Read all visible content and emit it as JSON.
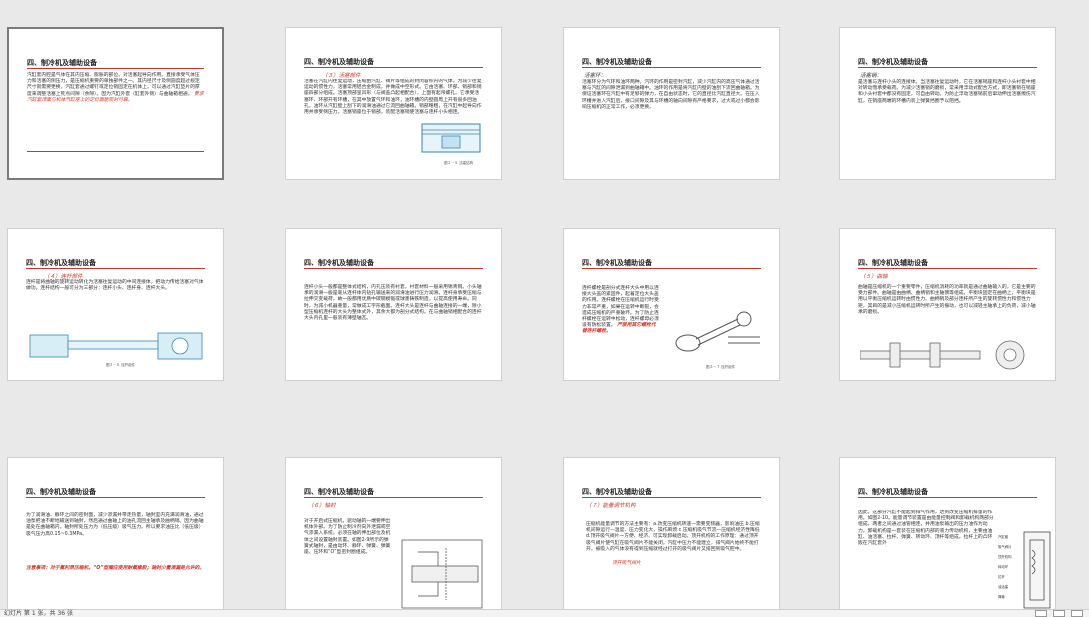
{
  "slides": [
    {
      "title": "四、制冷机及辅助设备",
      "text": "汽缸套内腔是气体在其内压缩、膨胀的部位。对活塞起导向作用。直接承受气体压力和活塞的侧压力，是压缩机重要的单独部件之一。其内径尺寸及侧圆度超过规定尺寸就需要更换。汽缸套通过螺钉或定位销固定在机体上，可以通过汽缸垫片的厚度来调整活塞上死点间隙（余隙）。因为汽缸外套（缸套外侧）与曲轴箱相通，",
      "note": "要求汽缸套顶面与机体气缸座上的定位面能密封可靠。"
    },
    {
      "title": "四、制冷机及辅助设备",
      "heading": "（３）活塞部件",
      "text": "活塞在汽缸内往复运动，压缩由汽缸、阀片等组成的封闭容积内的气体。为减少往复运动的惯性力，活塞常用铝合金制成，并做成中空形式。它由活塞、环部、销部和销座四部分组成。活塞顶部呈凹形（与阀盖凸起相配合），上面有起吊螺孔。它承受活塞环、环部开有环槽，在其中放置气环和油环，油环槽的内壁圆周上开有很多回油孔，油环从汽缸壁上刮下的润滑油通过它流回曲轴箱。销部略粗，在汽缸中起导向作用并承受侧压力。活塞销座位于销部，装配活塞销使活塞与连杆小头相连。",
      "caption": "图２－５ 活塞结构"
    },
    {
      "title": "四、制冷机及辅助设备",
      "heading": "活塞环：",
      "text": "活塞环分为气环和油环两种。汽环的作用是密封汽缸，减少汽缸内的高压气体通过活塞与汽缸的间隙泄漏到曲轴箱中。油环的作用是将汽缸内壁的油刮下流回曲轴箱。为保证活塞环在汽缸中有足够的弹力，在自由状态时，它的直径比汽缸直径大。在压入环槽并进入汽缸后，接口间隙及其与环槽的轴向间隙有严格要求，过大或过小都会影响压缩机的正常工作，必须更换。"
    },
    {
      "title": "四、制冷机及辅助设备",
      "heading": "活塞销：",
      "text": "是活塞与连杆小头的连接体。当活塞往复运动时，它在活塞销座和连杆小头衬套中相对转动而承受载荷。为减少活塞销的磨损，常采用浮动式配合方式，即活塞销在销座和小头衬套中都没有固定，可自由转动。为防止浮动活塞销前后窜动伸出活塞擦伤汽缸，在销座两端的环槽内装上弹簧挡圈予以阻挡。"
    },
    {
      "title": "四、制冷机及辅助设备",
      "heading": "（４）连杆部件",
      "text": "连杆是将曲轴的旋转运动转化为活塞往复运动的中间连接体，把动力传给活塞对气体做功。连杆结构一般可分为三部分：连杆小头、连杆身、连杆大头。",
      "caption": "图２－６ 连杆组件"
    },
    {
      "title": "四、制冷机及辅助设备",
      "text": "连杆小头一般都是整体式结构，内孔压装有衬套，衬套材料一般采用锡青铜。小头轴承的润滑一般是靠从连杆体内钻孔输送来的润滑油进行压力润滑。连杆身承受压缩与拉伸交变载荷，故一般都用优质中碳钢模锻或球墨铸铁制造，以提高使用寿命。同时，为减小机器重量，常做成工字形截面。连杆大头是连杆与曲轴连接的一端，除小型压缩机连杆的大头为整体式外，其余大都为剖分式结构。在与曲轴销相配合的连杆大头内孔里一般装有薄壁轴瓦。"
    },
    {
      "title": "四、制冷机及辅助设备",
      "text": "连杆螺栓是剖分式连杆大头中用以连接大头盖的紧固件，起着定位大头盖的作用。连杆螺栓在压缩机运行时受力非常严重，如果在运转中断裂，会造成压缩机的严重破坏。为了防止连杆螺栓在运转中松动，连杆螺母必须设有防松装置。",
      "note": "严禁用其它螺栓代替连杆螺栓。",
      "caption": "图２－７ 连杆组件"
    },
    {
      "title": "四、制冷机及辅助设备",
      "heading": "（５）曲轴",
      "text": "曲轴是压缩机的一个重要零件，压缩机消耗的功率就是通过曲轴输入的，它是主要的受力部件。曲轴是由曲柄、曲柄销和主轴颈等组成，平衡块固定在曲柄上，平衡块是用以平衡压缩机运转时由惯性力、曲柄销及部分连杆所产生的旋转惯性力和惯性力矩，其目的是减小压缩机运转时所产生的振动，也可以减轻主轴承上的负荷，减小轴承的磨损。"
    },
    {
      "title": "四、制冷机及辅助设备",
      "text": "为了润滑油、静环之间的密封面，减少渗漏并带走热量，轴封室内充满润滑油，通过油泵把油不断地输送到轴封，然后通过曲轴上的油孔流回主轴承及曲柄销。因为曲轴是处在曲轴箱内，轴封所处压力为（低压级）吸气压力。所以要求油压比（低压级）吸气压力高0.15~0.3MPa。",
      "note": "注意事项：对于氟利昂压缩机，“O”型圈应使用耐氟橡胶；轴封少量渗漏是允许的。"
    },
    {
      "title": "四、制冷机及辅助设备",
      "heading": "（６）轴封",
      "text": "对于开启式压缩机，驱动轴的一端要伸出机体外部。为了防止制冷剂向外泄漏或空气渗漏入系统，必须在轴的伸出部位及机体之间设置轴封装置。如图2-9所示的弹簧式轴封，是由动环、静环、弹簧、弹簧座、压环和“O”型密封圈组成。"
    },
    {
      "title": "四、制冷机及辅助设备",
      "heading": "（７）能量调节机构",
      "text": "压缩机能量调节的方法主要有：a.改变压缩机转速—需要变频器，影响油压 b.压缩机间隙运行—温度、压力变化大，操作麻烦 c.压缩机吸气节流—压缩机经济性降低 d.顶开吸气阀片—方便、经济、可实现卸载启动。顶开机构的工作原理：通过顶开吸气阀片使气缸在吸气阀片不能关闭，汽缸中压力不能建立，排气阀片始终不能打开，被吸入的气体没有得到压缩就经过打开的吸气阀片又排回到吸气腔中。",
      "note": "顶开吸气阀片"
    },
    {
      "title": "四、制冷机及辅助设备",
      "text": "因此，这部分汽缸不能起到排气作用，达到改变压缩机排量的作用。如图2-10。能量调节装置是由能量控制阀和卸载机构两部分组成，两者之间通过油管相连，并用油泵输出的压力油作为动力。卸载机构是一套装在压缩机内部的液力传动机构，主要由油缸、油活塞、拉杆、弹簧、转动环、顶杆等组成。拉杆上的凸环嵌在汽缸套外",
      "labels": [
        "汽缸套",
        "吸气阀片",
        "顶开机构",
        "转动环",
        "拉杆",
        "油活塞",
        "弹簧"
      ]
    }
  ],
  "status": {
    "left_text": "幻灯片 第 1 张，共 36 张"
  }
}
